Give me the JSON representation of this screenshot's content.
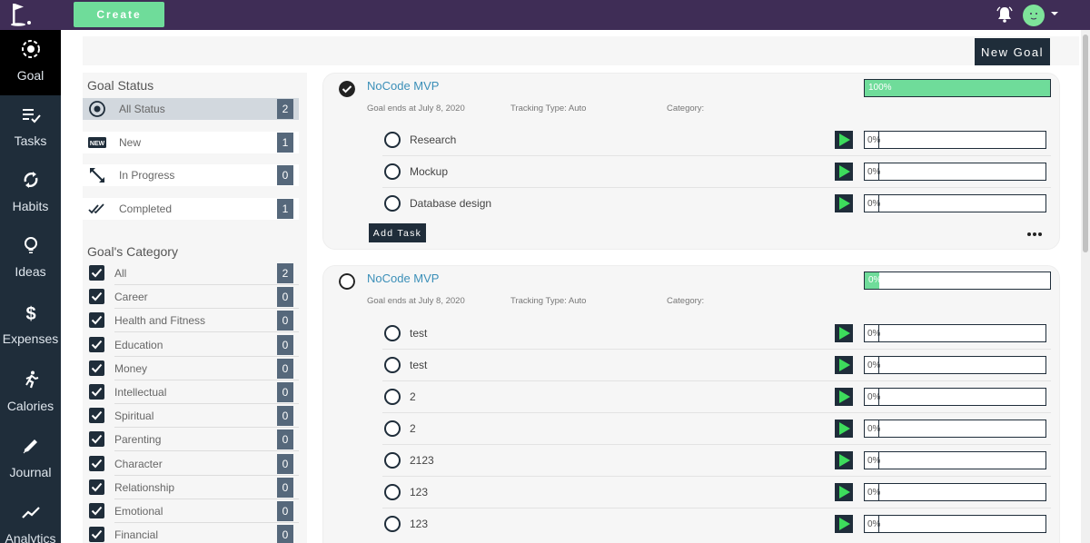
{
  "topbar": {
    "create_label": "Create"
  },
  "sidebar": {
    "items": [
      {
        "label": "Goal",
        "icon": "target-icon"
      },
      {
        "label": "Tasks",
        "icon": "checklist-icon"
      },
      {
        "label": "Habits",
        "icon": "sync-icon"
      },
      {
        "label": "Ideas",
        "icon": "lightbulb-icon"
      },
      {
        "label": "Expenses",
        "icon": "dollar-icon"
      },
      {
        "label": "Calories",
        "icon": "running-icon"
      },
      {
        "label": "Journal",
        "icon": "pencil-icon"
      },
      {
        "label": "Analytics",
        "icon": "trend-icon"
      }
    ]
  },
  "toolbar": {
    "new_goal_label": "New Goal"
  },
  "filters": {
    "status_heading": "Goal Status",
    "statuses": [
      {
        "label": "All Status",
        "count": "2",
        "icon": "radio-selected-icon"
      },
      {
        "label": "New",
        "count": "1",
        "icon": "new-badge-icon"
      },
      {
        "label": "In Progress",
        "count": "0",
        "icon": "expand-arrows-icon"
      },
      {
        "label": "Completed",
        "count": "1",
        "icon": "double-check-icon"
      }
    ],
    "category_heading": "Goal's Category",
    "categories": [
      {
        "label": "All",
        "count": "2"
      },
      {
        "label": "Career",
        "count": "0"
      },
      {
        "label": "Health and Fitness",
        "count": "0"
      },
      {
        "label": "Education",
        "count": "0"
      },
      {
        "label": "Money",
        "count": "0"
      },
      {
        "label": "Intellectual",
        "count": "0"
      },
      {
        "label": "Spiritual",
        "count": "0"
      },
      {
        "label": "Parenting",
        "count": "0"
      },
      {
        "label": "Character",
        "count": "0"
      },
      {
        "label": "Relationship",
        "count": "0"
      },
      {
        "label": "Emotional",
        "count": "0"
      },
      {
        "label": "Financial",
        "count": "0"
      }
    ]
  },
  "goals": [
    {
      "title": "NoCode MVP",
      "ends": "Goal ends at July 8, 2020",
      "tracking": "Tracking Type: Auto",
      "category": "Category:",
      "progress": "100%",
      "progress_value": 100,
      "completed": true,
      "add_task_label": "Add Task",
      "tasks": [
        {
          "name": "Research",
          "progress": "0%"
        },
        {
          "name": "Mockup",
          "progress": "0%"
        },
        {
          "name": "Database design",
          "progress": "0%"
        }
      ]
    },
    {
      "title": "NoCode MVP",
      "ends": "Goal ends at July 8, 2020",
      "tracking": "Tracking Type: Auto",
      "category": "Category:",
      "progress": "0%",
      "progress_value": 0,
      "completed": false,
      "tasks": [
        {
          "name": "test",
          "progress": "0%"
        },
        {
          "name": "test",
          "progress": "0%"
        },
        {
          "name": "2",
          "progress": "0%"
        },
        {
          "name": "2",
          "progress": "0%"
        },
        {
          "name": "2123",
          "progress": "0%"
        },
        {
          "name": "123",
          "progress": "0%"
        },
        {
          "name": "123",
          "progress": "0%"
        }
      ]
    }
  ],
  "colors": {
    "accent": "#6fdc9a",
    "topbar": "#3f2d56",
    "sidebar": "#1f2d3a",
    "link": "#3b8fb8"
  }
}
